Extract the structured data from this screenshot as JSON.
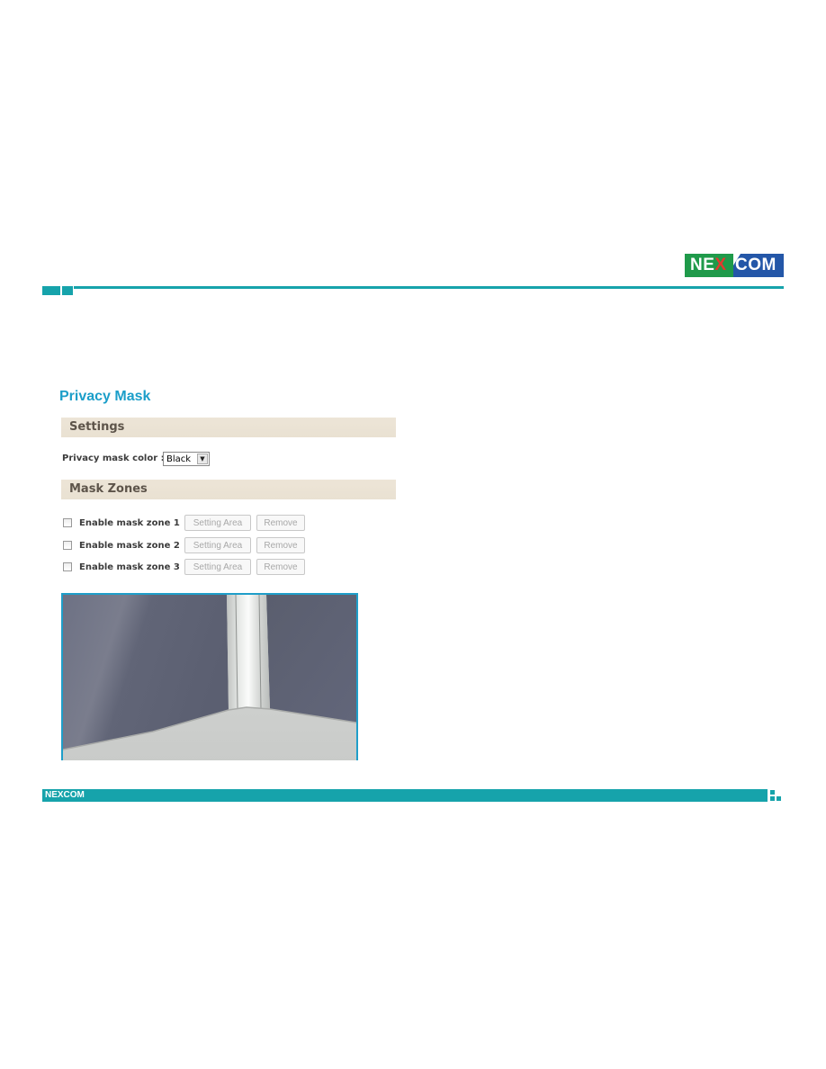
{
  "header": {
    "brand_left": "NE",
    "brand_x": "X",
    "brand_right": "COM"
  },
  "page": {
    "title": "Privacy Mask"
  },
  "settings": {
    "section_title": "Settings",
    "color_label": "Privacy mask color :",
    "color_value": "Black"
  },
  "mask_zones": {
    "section_title": "Mask Zones",
    "zones": [
      {
        "label": "Enable mask zone 1",
        "checked": false,
        "setting_label": "Setting Area",
        "remove_label": "Remove"
      },
      {
        "label": "Enable mask zone 2",
        "checked": false,
        "setting_label": "Setting Area",
        "remove_label": "Remove"
      },
      {
        "label": "Enable mask zone 3",
        "checked": false,
        "setting_label": "Setting Area",
        "remove_label": "Remove"
      }
    ]
  },
  "video": {
    "description": "Camera live view: corner of grey cubicle partition walls with a white vertical pillar"
  },
  "footer": {
    "brand": "NEXCOM"
  },
  "colors": {
    "brand_teal": "#16a3ab",
    "title_blue": "#1b9ec9",
    "section_beige": "#ede5d7",
    "logo_green": "#1f9a4a",
    "logo_blue": "#2457a8"
  }
}
